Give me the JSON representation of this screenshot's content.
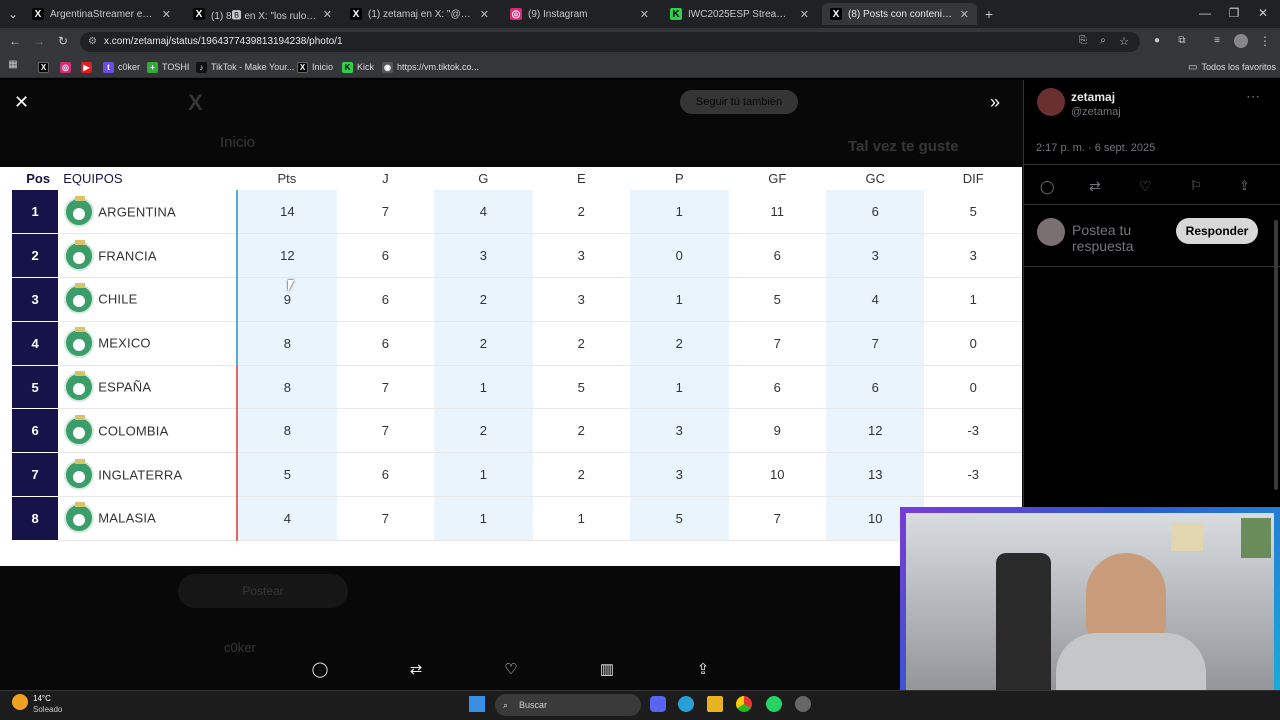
{
  "tabs": [
    {
      "title": "ArgentinaStreamer en X: \"Vamo",
      "icon": "x",
      "active": false
    },
    {
      "title": "(1) 8🅱 en X: \"los rulos, la vinch",
      "icon": "x",
      "active": false
    },
    {
      "title": "(1) zetamaj en X: \"@c0ker_ tabl",
      "icon": "x",
      "active": false
    },
    {
      "title": "(9) Instagram",
      "icon": "instagram",
      "active": false
    },
    {
      "title": "IWC2025ESP Stream - Wate",
      "icon": "kick",
      "active": false
    },
    {
      "title": "(8) Posts con contenido multim",
      "icon": "x",
      "active": true
    }
  ],
  "url": "x.com/zetamaj/status/1964377439813194238/photo/1",
  "bookmarks": [
    "",
    "",
    "",
    "c0ker",
    "TOSHI",
    "TikTok - Make Your...",
    "Inicio",
    "Kick",
    "https://vm.tiktok.co..."
  ],
  "bookmarks_all": "Todos los favoritos",
  "post": {
    "display_name": "zetamaj",
    "handle": "@zetamaj",
    "timestamp": "2:17 p. m. · 6 sept. 2025",
    "reply_placeholder": "Postea tu respuesta",
    "reply_button": "Responder"
  },
  "standings": {
    "headers": [
      "Pos",
      "EQUIPOS",
      "Pts",
      "J",
      "G",
      "E",
      "P",
      "GF",
      "GC",
      "DIF"
    ],
    "rows": [
      {
        "pos": "1",
        "team": "ARGENTINA",
        "pts": "14",
        "j": "7",
        "g": "4",
        "e": "2",
        "p": "1",
        "gf": "11",
        "gc": "6",
        "dif": "5",
        "zone": "qualify"
      },
      {
        "pos": "2",
        "team": "FRANCIA",
        "pts": "12",
        "j": "6",
        "g": "3",
        "e": "3",
        "p": "0",
        "gf": "6",
        "gc": "3",
        "dif": "3",
        "zone": "qualify"
      },
      {
        "pos": "3",
        "team": "CHILE",
        "pts": "9",
        "j": "6",
        "g": "2",
        "e": "3",
        "p": "1",
        "gf": "5",
        "gc": "4",
        "dif": "1",
        "zone": "qualify"
      },
      {
        "pos": "4",
        "team": "MEXICO",
        "pts": "8",
        "j": "6",
        "g": "2",
        "e": "2",
        "p": "2",
        "gf": "7",
        "gc": "7",
        "dif": "0",
        "zone": "qualify"
      },
      {
        "pos": "5",
        "team": "ESPAÑA",
        "pts": "8",
        "j": "7",
        "g": "1",
        "e": "5",
        "p": "1",
        "gf": "6",
        "gc": "6",
        "dif": "0",
        "zone": "out"
      },
      {
        "pos": "6",
        "team": "COLOMBIA",
        "pts": "8",
        "j": "7",
        "g": "2",
        "e": "2",
        "p": "3",
        "gf": "9",
        "gc": "12",
        "dif": "-3",
        "zone": "out"
      },
      {
        "pos": "7",
        "team": "INGLATERRA",
        "pts": "5",
        "j": "6",
        "g": "1",
        "e": "2",
        "p": "3",
        "gf": "10",
        "gc": "13",
        "dif": "-3",
        "zone": "out"
      },
      {
        "pos": "8",
        "team": "MALASIA",
        "pts": "4",
        "j": "7",
        "g": "1",
        "e": "1",
        "p": "5",
        "gf": "7",
        "gc": "10",
        "dif": "",
        "zone": "out"
      }
    ]
  },
  "ghost_text": {
    "logo": "X",
    "home": "Inicio",
    "follow": "Seguir tú también",
    "also_like": "Tal vez te guste",
    "post_btn": "Postear",
    "name": "c0ker"
  },
  "weather": {
    "temp": "14°C",
    "desc": "Soleado"
  },
  "taskbar_search": "Buscar",
  "colors": {
    "team_navy": "#16134a",
    "qualify": "#5aa9d6",
    "out": "#e36464",
    "shade": "#eaf4fc"
  }
}
